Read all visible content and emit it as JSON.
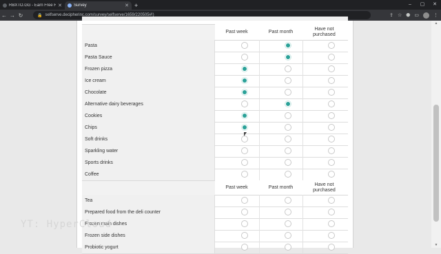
{
  "browser": {
    "tabs": [
      {
        "title": "RBXTO.GG - Earn Free Robux R$",
        "active": false
      },
      {
        "title": "Survey",
        "active": true
      }
    ],
    "new_tab": "+",
    "url": "selfserve.decipherinc.com/survey/selfserve/1659/220505#!)",
    "window_controls": {
      "minimize": "–",
      "maximize": "▢",
      "close": "✕"
    },
    "nav": {
      "back": "←",
      "forward": "→",
      "reload": "↻"
    },
    "toolbar_icons": {
      "share": "⇪",
      "bookmark": "☆",
      "extensions": "⬣",
      "sidebar": "▭",
      "menu": "⋮"
    }
  },
  "survey": {
    "columns": [
      "Past week",
      "Past month",
      "Have not\npurchased"
    ],
    "groups": [
      {
        "items": [
          {
            "label": "Pasta",
            "selected": 1
          },
          {
            "label": "Pasta Sauce",
            "selected": 1
          },
          {
            "label": "Frozen pizza",
            "selected": 0
          },
          {
            "label": "Ice cream",
            "selected": 0
          },
          {
            "label": "Chocolate",
            "selected": 0
          },
          {
            "label": "Alternative dairy beverages",
            "selected": 1
          },
          {
            "label": "Cookies",
            "selected": 0
          },
          {
            "label": "Chips",
            "selected": 0
          },
          {
            "label": "Soft drinks",
            "selected": -1
          },
          {
            "label": "Sparkling water",
            "selected": -1
          },
          {
            "label": "Sports drinks",
            "selected": -1
          },
          {
            "label": "Coffee",
            "selected": -1
          }
        ]
      },
      {
        "items": [
          {
            "label": "Tea",
            "selected": -1
          },
          {
            "label": "Prepared food from the deli counter",
            "selected": -1
          },
          {
            "label": "Frozen main dishes",
            "selected": -1
          },
          {
            "label": "Frozen side dishes",
            "selected": -1
          },
          {
            "label": "Probiotic yogurt",
            "selected": -1
          }
        ]
      }
    ],
    "accent_color": "#2aa198"
  },
  "watermark": "YT: HyperCloud"
}
